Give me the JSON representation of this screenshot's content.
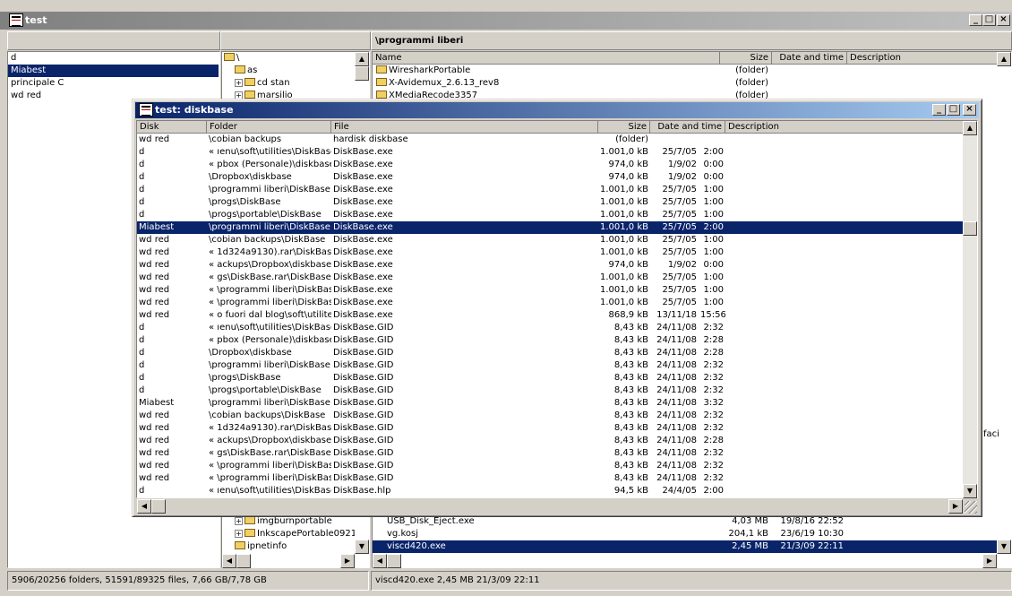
{
  "main_window": {
    "title": "test",
    "min_glyph": "_",
    "max_glyph": "□",
    "close_glyph": "×"
  },
  "disks_panel": {
    "items": [
      {
        "label": "d",
        "selected": false
      },
      {
        "label": "Miabest",
        "selected": true
      },
      {
        "label": "principale C",
        "selected": false
      },
      {
        "label": "wd red",
        "selected": false
      }
    ]
  },
  "tree_panel": {
    "items": [
      {
        "label": "\\",
        "kind": "root"
      },
      {
        "label": "as",
        "kind": "leaf"
      },
      {
        "label": "cd stan",
        "kind": "plus"
      },
      {
        "label": "marsilio",
        "kind": "plus"
      }
    ],
    "bottom_items": [
      {
        "label": "imgburnportable",
        "kind": "plus"
      },
      {
        "label": "InkscapePortable0921",
        "kind": "plus"
      },
      {
        "label": "ipnetinfo",
        "kind": "leaf"
      }
    ]
  },
  "files_panel": {
    "path": "\\programmi liberi",
    "columns": {
      "name": "Name",
      "size": "Size",
      "date": "Date and time",
      "desc": "Description"
    },
    "rows": [
      {
        "name": "WiresharkPortable",
        "size": "(folder)",
        "date": "",
        "folder": true
      },
      {
        "name": "X-Avidemux_2.6.13_rev8",
        "size": "(folder)",
        "date": "",
        "folder": true
      },
      {
        "name": "XMediaRecode3357",
        "size": "(folder)",
        "date": "",
        "folder": true
      }
    ],
    "bottom_rows": [
      {
        "name": "USB_Disk_Eject.exe",
        "size": "4,03 MB",
        "date": "19/8/16 22:52",
        "selected": false
      },
      {
        "name": "vg.kosj",
        "size": "204,1 kB",
        "date": "23/6/19 10:30",
        "selected": false
      },
      {
        "name": "viscd420.exe",
        "size": "2,45 MB",
        "date": "21/3/09 22:11",
        "selected": true
      }
    ],
    "partial_desc": "faci"
  },
  "status": {
    "left": "5906/20256 folders, 51591/89325 files, 7,66 GB/7,78 GB",
    "right": "viscd420.exe   2,45 MB   21/3/09 22:11"
  },
  "dialog": {
    "title": "test: diskbase",
    "columns": {
      "disk": "Disk",
      "folder": "Folder",
      "file": "File",
      "size": "Size",
      "date": "Date and time",
      "desc": "Description"
    },
    "rows": [
      {
        "disk": "wd red",
        "folder": "\\cobian backups",
        "file": "hardisk diskbase",
        "size": "(folder)",
        "date": "",
        "time": ""
      },
      {
        "disk": "d",
        "folder": "« ıenu\\soft\\utilities\\DiskBase",
        "file": "DiskBase.exe",
        "size": "1.001,0 kB",
        "date": "25/7/05",
        "time": "2:00"
      },
      {
        "disk": "d",
        "folder": "« pbox (Personale)\\diskbase",
        "file": "DiskBase.exe",
        "size": "974,0 kB",
        "date": "1/9/02",
        "time": "0:00"
      },
      {
        "disk": "d",
        "folder": "\\Dropbox\\diskbase",
        "file": "DiskBase.exe",
        "size": "974,0 kB",
        "date": "1/9/02",
        "time": "0:00"
      },
      {
        "disk": "d",
        "folder": "\\programmi liberi\\DiskBase",
        "file": "DiskBase.exe",
        "size": "1.001,0 kB",
        "date": "25/7/05",
        "time": "1:00"
      },
      {
        "disk": "d",
        "folder": "\\progs\\DiskBase",
        "file": "DiskBase.exe",
        "size": "1.001,0 kB",
        "date": "25/7/05",
        "time": "1:00"
      },
      {
        "disk": "d",
        "folder": "\\progs\\portable\\DiskBase",
        "file": "DiskBase.exe",
        "size": "1.001,0 kB",
        "date": "25/7/05",
        "time": "1:00"
      },
      {
        "disk": "Miabest",
        "folder": "\\programmi liberi\\DiskBase",
        "file": "DiskBase.exe",
        "size": "1.001,0 kB",
        "date": "25/7/05",
        "time": "2:00",
        "selected": true
      },
      {
        "disk": "wd red",
        "folder": "\\cobian backups\\DiskBase",
        "file": "DiskBase.exe",
        "size": "1.001,0 kB",
        "date": "25/7/05",
        "time": "1:00"
      },
      {
        "disk": "wd red",
        "folder": "« 1d324a9130).rar\\DiskBase",
        "file": "DiskBase.exe",
        "size": "1.001,0 kB",
        "date": "25/7/05",
        "time": "1:00"
      },
      {
        "disk": "wd red",
        "folder": "« ackups\\Dropbox\\diskbase",
        "file": "DiskBase.exe",
        "size": "974,0 kB",
        "date": "1/9/02",
        "time": "0:00"
      },
      {
        "disk": "wd red",
        "folder": "« gs\\DiskBase.rar\\DiskBase",
        "file": "DiskBase.exe",
        "size": "1.001,0 kB",
        "date": "25/7/05",
        "time": "1:00"
      },
      {
        "disk": "wd red",
        "folder": "« \\programmi liberi\\DiskBase",
        "file": "DiskBase.exe",
        "size": "1.001,0 kB",
        "date": "25/7/05",
        "time": "1:00"
      },
      {
        "disk": "wd red",
        "folder": "« \\programmi liberi\\DiskBase",
        "file": "DiskBase.exe",
        "size": "1.001,0 kB",
        "date": "25/7/05",
        "time": "1:00"
      },
      {
        "disk": "wd red",
        "folder": "« o fuori dal blog\\soft\\utilites",
        "file": "DiskBase.exe",
        "size": "868,9 kB",
        "date": "13/11/18",
        "time": "15:56"
      },
      {
        "disk": "d",
        "folder": "« ıenu\\soft\\utilities\\DiskBase",
        "file": "DiskBase.GID",
        "size": "8,43 kB",
        "date": "24/11/08",
        "time": "2:32"
      },
      {
        "disk": "d",
        "folder": "« pbox (Personale)\\diskbase",
        "file": "DiskBase.GID",
        "size": "8,43 kB",
        "date": "24/11/08",
        "time": "2:28"
      },
      {
        "disk": "d",
        "folder": "\\Dropbox\\diskbase",
        "file": "DiskBase.GID",
        "size": "8,43 kB",
        "date": "24/11/08",
        "time": "2:28"
      },
      {
        "disk": "d",
        "folder": "\\programmi liberi\\DiskBase",
        "file": "DiskBase.GID",
        "size": "8,43 kB",
        "date": "24/11/08",
        "time": "2:32"
      },
      {
        "disk": "d",
        "folder": "\\progs\\DiskBase",
        "file": "DiskBase.GID",
        "size": "8,43 kB",
        "date": "24/11/08",
        "time": "2:32"
      },
      {
        "disk": "d",
        "folder": "\\progs\\portable\\DiskBase",
        "file": "DiskBase.GID",
        "size": "8,43 kB",
        "date": "24/11/08",
        "time": "2:32"
      },
      {
        "disk": "Miabest",
        "folder": "\\programmi liberi\\DiskBase",
        "file": "DiskBase.GID",
        "size": "8,43 kB",
        "date": "24/11/08",
        "time": "3:32"
      },
      {
        "disk": "wd red",
        "folder": "\\cobian backups\\DiskBase",
        "file": "DiskBase.GID",
        "size": "8,43 kB",
        "date": "24/11/08",
        "time": "2:32"
      },
      {
        "disk": "wd red",
        "folder": "« 1d324a9130).rar\\DiskBase",
        "file": "DiskBase.GID",
        "size": "8,43 kB",
        "date": "24/11/08",
        "time": "2:32"
      },
      {
        "disk": "wd red",
        "folder": "« ackups\\Dropbox\\diskbase",
        "file": "DiskBase.GID",
        "size": "8,43 kB",
        "date": "24/11/08",
        "time": "2:28"
      },
      {
        "disk": "wd red",
        "folder": "« gs\\DiskBase.rar\\DiskBase",
        "file": "DiskBase.GID",
        "size": "8,43 kB",
        "date": "24/11/08",
        "time": "2:32"
      },
      {
        "disk": "wd red",
        "folder": "« \\programmi liberi\\DiskBase",
        "file": "DiskBase.GID",
        "size": "8,43 kB",
        "date": "24/11/08",
        "time": "2:32"
      },
      {
        "disk": "wd red",
        "folder": "« \\programmi liberi\\DiskBase",
        "file": "DiskBase.GID",
        "size": "8,43 kB",
        "date": "24/11/08",
        "time": "2:32"
      },
      {
        "disk": "d",
        "folder": "« ıenu\\soft\\utilities\\DiskBase",
        "file": "DiskBase.hlp",
        "size": "94,5 kB",
        "date": "24/4/05",
        "time": "2:00"
      }
    ]
  },
  "colors": {
    "selection": "#0a246a",
    "title_active": "#0a246a",
    "face": "#d4d0c8"
  }
}
